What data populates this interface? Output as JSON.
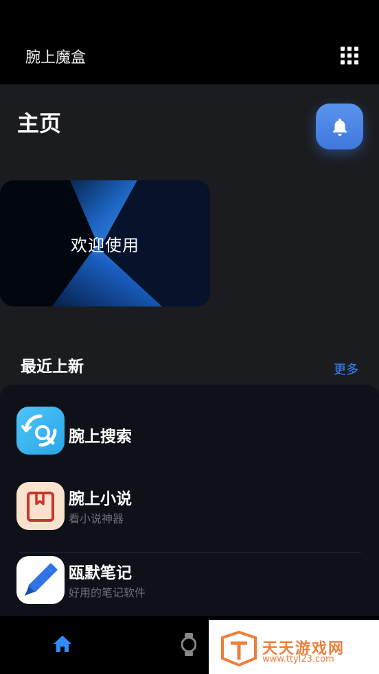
{
  "header": {
    "title": "腕上魔盒",
    "menu_icon": "apps-grid-icon"
  },
  "page": {
    "title": "主页",
    "notify_icon": "bell-icon",
    "accent": "#4a86e8"
  },
  "banner": {
    "text": "欢迎使用"
  },
  "recent": {
    "title": "最近上新",
    "more_label": "更多",
    "more_color": "#3a86ff"
  },
  "apps": [
    {
      "title": "腕上搜索",
      "subtitle": "",
      "icon": "search-app-icon"
    },
    {
      "title": "腕上小说",
      "subtitle": "看小说神器",
      "icon": "book-app-icon"
    },
    {
      "title": "瓯默笔记",
      "subtitle": "好用的笔记软件",
      "icon": "pen-app-icon"
    }
  ],
  "nav": {
    "home_icon": "home-icon",
    "watch_icon": "watch-icon"
  },
  "watermark": {
    "name": "天天游戏网",
    "url": "www.ttyl23.com"
  }
}
